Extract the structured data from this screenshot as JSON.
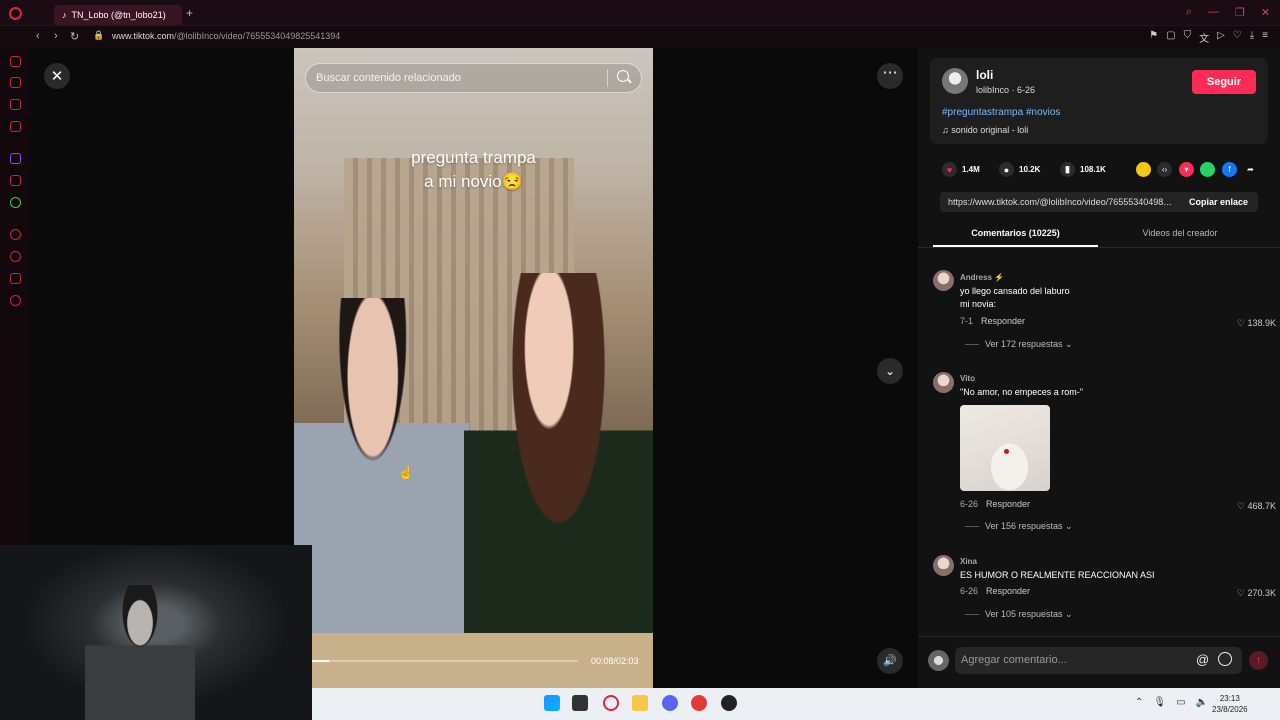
{
  "browser": {
    "tab_title": "TN_Lobo (@tn_lobo21)",
    "url_domain": "www.tiktok.com",
    "url_path": "/@lolibInco/video/7655534049825541394"
  },
  "video": {
    "search_placeholder": "Buscar contenido relacionado",
    "caption_line1": "pregunta trampa",
    "caption_line2": "a mi novio😒",
    "time": "00:08/02:03",
    "progress_fraction": 0.065
  },
  "creator": {
    "name": "loli",
    "handle_date": "lolibInco · 6-26",
    "follow_label": "Seguir",
    "hashtags": "#preguntastrampa #novios",
    "sound": "sonido original - loli"
  },
  "stats": {
    "likes": "1.4M",
    "comments": "10.2K",
    "saves": "108.1K"
  },
  "share": {
    "link": "https://www.tiktok.com/@lolibInco/video/7655534049825541394",
    "copy_label": "Copiar enlace"
  },
  "tabs": {
    "comments": "Comentarios (10225)",
    "videos": "Videos del creador"
  },
  "comments": [
    {
      "user": "Andress ⚡",
      "text1": "yo llego cansado del laburo",
      "text2": "mi novia:",
      "date": "7-1",
      "reply": "Responder",
      "likes": "138.9K",
      "replies": "Ver 172 respuestas ⌄"
    },
    {
      "user": "Vito",
      "text1": "\"No amor, no empeces a rom-\"",
      "date": "6-26",
      "reply": "Responder",
      "likes": "468.7K",
      "replies": "Ver 156 respuestas ⌄"
    },
    {
      "user": "Xina",
      "text1": "ES HUMOR O REALMENTE REACCIONAN ASI",
      "date": "6-26",
      "reply": "Responder",
      "likes": "270.3K",
      "replies": "Ver 105 respuestas ⌄"
    }
  ],
  "comment_bar": {
    "placeholder": "Agregar comentario..."
  },
  "clock": {
    "time": "23:13",
    "date": "23/8/2026"
  },
  "colors": {
    "accent": "#fe2c55",
    "hashtag": "#7cb7ff",
    "opera_red": "#e0243c"
  }
}
